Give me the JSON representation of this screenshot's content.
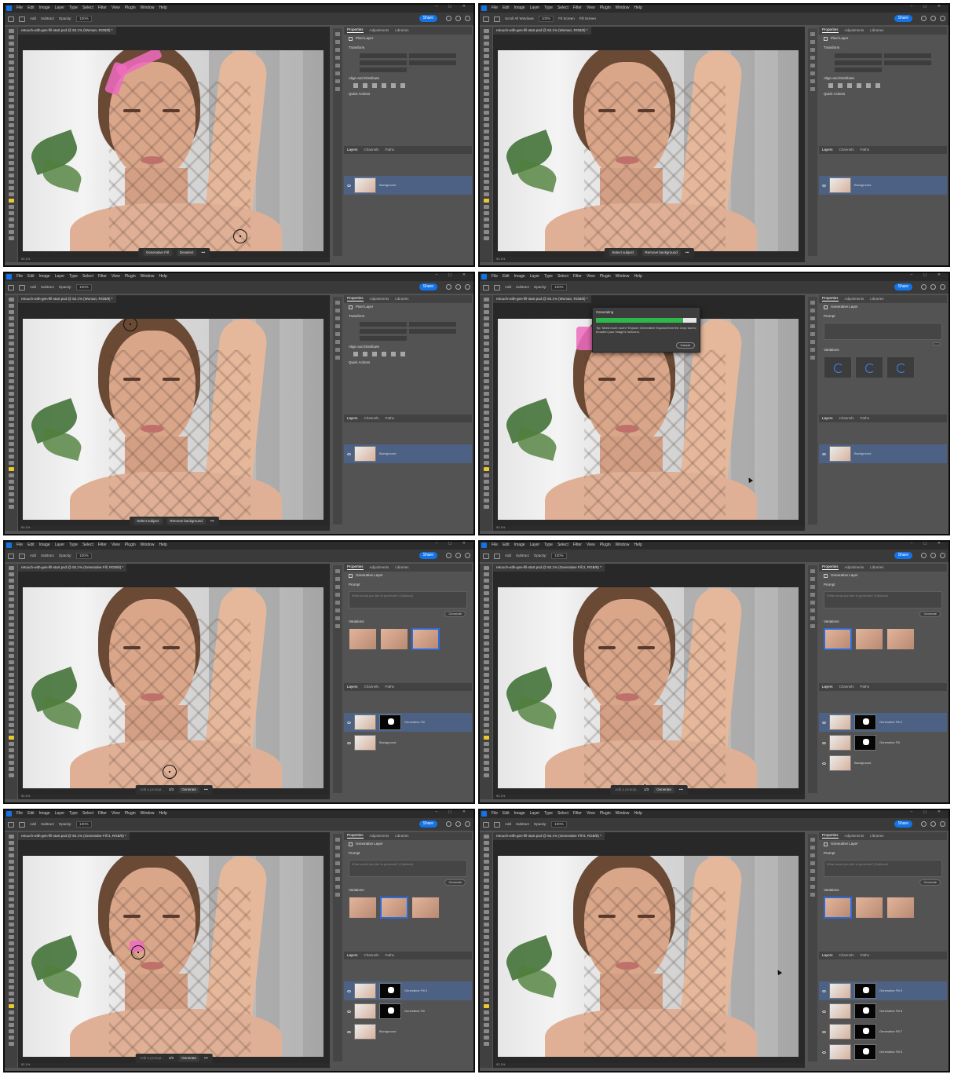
{
  "menu": [
    "File",
    "Edit",
    "Image",
    "Layer",
    "Type",
    "Select",
    "Filter",
    "View",
    "Plugin",
    "Window",
    "Help"
  ],
  "share_label": "Share",
  "frames": [
    {
      "doc_title": "retouch-with-gen-fill-start.psd @ 92.1% (Woman, RGB/8) *",
      "options": [
        "Add",
        "Subtract",
        "Opacity:",
        "100%"
      ],
      "context_bar": [
        "Generative Fill",
        "Deselect"
      ],
      "prop_tabs": [
        "Properties",
        "Adjustments",
        "Libraries"
      ],
      "prop_kind": "Pixel Layer",
      "sections": [
        "Transform",
        "Align and Distribute",
        "Quick Actions"
      ],
      "layer_tabs": [
        "Layers",
        "Channels",
        "Paths"
      ],
      "layers": [
        {
          "name": "Background",
          "selected": true,
          "mask": false
        }
      ]
    },
    {
      "doc_title": "retouch-with-gen-fill-start.psd @ 92.1% (Woman, RGB/8) *",
      "options": [
        "Scroll All Windows",
        "100%",
        "Fit Screen",
        "Fill Screen"
      ],
      "context_bar": [
        "Select subject",
        "Remove background"
      ],
      "prop_tabs": [
        "Properties",
        "Adjustments",
        "Libraries"
      ],
      "prop_kind": "Pixel Layer",
      "sections": [
        "Transform",
        "Align and Distribute",
        "Quick Actions"
      ],
      "layer_tabs": [
        "Layers",
        "Channels",
        "Paths"
      ],
      "layers": [
        {
          "name": "Background",
          "selected": true,
          "mask": false
        }
      ]
    },
    {
      "doc_title": "retouch-with-gen-fill-start.psd @ 92.1% (Woman, RGB/8) *",
      "options": [
        "Add",
        "Subtract",
        "Opacity:",
        "100%"
      ],
      "context_bar": [
        "Select subject",
        "Remove background"
      ],
      "prop_tabs": [
        "Properties",
        "Adjustments",
        "Libraries"
      ],
      "prop_kind": "Pixel Layer",
      "sections": [
        "Transform",
        "Align and Distribute",
        "Quick Actions"
      ],
      "layer_tabs": [
        "Layers",
        "Channels",
        "Paths"
      ],
      "layers": [
        {
          "name": "Background",
          "selected": true,
          "mask": false
        }
      ]
    },
    {
      "doc_title": "retouch-with-gen-fill-start.psd @ 92.1% (Woman, RGB/8) *",
      "options": [
        "Add",
        "Subtract",
        "Opacity:",
        "100%"
      ],
      "context_bar": [],
      "prop_tabs": [
        "Properties",
        "Adjustments",
        "Libraries"
      ],
      "prop_kind": "Generative Layer",
      "sections": [
        "Prompt",
        "Variations"
      ],
      "variations": 3,
      "variations_loading": true,
      "layer_tabs": [
        "Layers",
        "Channels",
        "Paths"
      ],
      "layers": [
        {
          "name": "Background",
          "selected": true,
          "mask": false
        }
      ],
      "dialog": {
        "title": "Generating",
        "progress": 0.87,
        "tip": "Tip: Need more room? Explore Generative Expand from the Crop tool to broaden your image's horizons.",
        "cancel": "Cancel"
      }
    },
    {
      "doc_title": "retouch-with-gen-fill-start.psd @ 92.1% (Generative Fill, RGB/8) *",
      "options": [
        "Add",
        "Subtract",
        "Opacity:",
        "100%"
      ],
      "context_bar": [
        "Add a prompt...",
        "3/3",
        "Generate"
      ],
      "prop_tabs": [
        "Properties",
        "Adjustments",
        "Libraries"
      ],
      "prop_kind": "Generative Layer",
      "sections": [
        "Prompt",
        "Variations"
      ],
      "prompt_placeholder": "What would you like to generate? (Optional)",
      "generate_label": "Generate",
      "variations": 3,
      "selected_variation": 3,
      "layer_tabs": [
        "Layers",
        "Channels",
        "Paths"
      ],
      "layers": [
        {
          "name": "Generative Fill",
          "selected": true,
          "mask": true
        },
        {
          "name": "Background",
          "selected": false,
          "mask": false
        }
      ]
    },
    {
      "doc_title": "retouch-with-gen-fill-start.psd @ 92.1% (Generative Fill 2, RGB/8) *",
      "options": [
        "Add",
        "Subtract",
        "Opacity:",
        "100%"
      ],
      "context_bar": [
        "Add a prompt...",
        "1/3",
        "Generate"
      ],
      "prop_tabs": [
        "Properties",
        "Adjustments",
        "Libraries"
      ],
      "prop_kind": "Generative Layer",
      "sections": [
        "Prompt",
        "Variations"
      ],
      "prompt_placeholder": "What would you like to generate? (Optional)",
      "generate_label": "Generate",
      "variations": 3,
      "selected_variation": 1,
      "layer_tabs": [
        "Layers",
        "Channels",
        "Paths"
      ],
      "layers": [
        {
          "name": "Generative Fill 2",
          "selected": true,
          "mask": true
        },
        {
          "name": "Generative Fill",
          "selected": false,
          "mask": true
        },
        {
          "name": "Background",
          "selected": false,
          "mask": false
        }
      ]
    },
    {
      "doc_title": "retouch-with-gen-fill-start.psd @ 92.1% (Generative Fill 3, RGB/8) *",
      "options": [
        "Add",
        "Subtract",
        "Opacity:",
        "100%"
      ],
      "context_bar": [
        "Add a prompt...",
        "2/3",
        "Generate"
      ],
      "prop_tabs": [
        "Properties",
        "Adjustments",
        "Libraries"
      ],
      "prop_kind": "Generative Layer",
      "sections": [
        "Prompt",
        "Variations"
      ],
      "prompt_placeholder": "What would you like to generate? (Optional)",
      "generate_label": "Generate",
      "variations": 3,
      "selected_variation": 2,
      "layer_tabs": [
        "Layers",
        "Channels",
        "Paths"
      ],
      "layers": [
        {
          "name": "Generative Fill 3",
          "selected": true,
          "mask": true
        },
        {
          "name": "Generative Fill",
          "selected": false,
          "mask": true
        },
        {
          "name": "Background",
          "selected": false,
          "mask": false
        }
      ]
    },
    {
      "doc_title": "retouch-with-gen-fill-start.psd @ 92.1% (Generative Fill 9, RGB/8) *",
      "options": [
        "Add",
        "Subtract",
        "Opacity:",
        "100%"
      ],
      "context_bar": [],
      "prop_tabs": [
        "Properties",
        "Adjustments",
        "Libraries"
      ],
      "prop_kind": "Generative Layer",
      "sections": [
        "Prompt",
        "Variations"
      ],
      "prompt_placeholder": "What would you like to generate? (Optional)",
      "generate_label": "Generate",
      "variations": 3,
      "selected_variation": 1,
      "layer_tabs": [
        "Layers",
        "Channels",
        "Paths"
      ],
      "layers": [
        {
          "name": "Generative Fill 9",
          "selected": true,
          "mask": true
        },
        {
          "name": "Generative Fill 8",
          "selected": false,
          "mask": true
        },
        {
          "name": "Generative Fill 7",
          "selected": false,
          "mask": true
        },
        {
          "name": "Generative Fill 5",
          "selected": false,
          "mask": true
        }
      ]
    }
  ],
  "colors": {
    "accent": "#1473e6",
    "selection_mark": "#f06bbf",
    "layer_selected": "#4d6185",
    "progress": "#2db84b"
  }
}
